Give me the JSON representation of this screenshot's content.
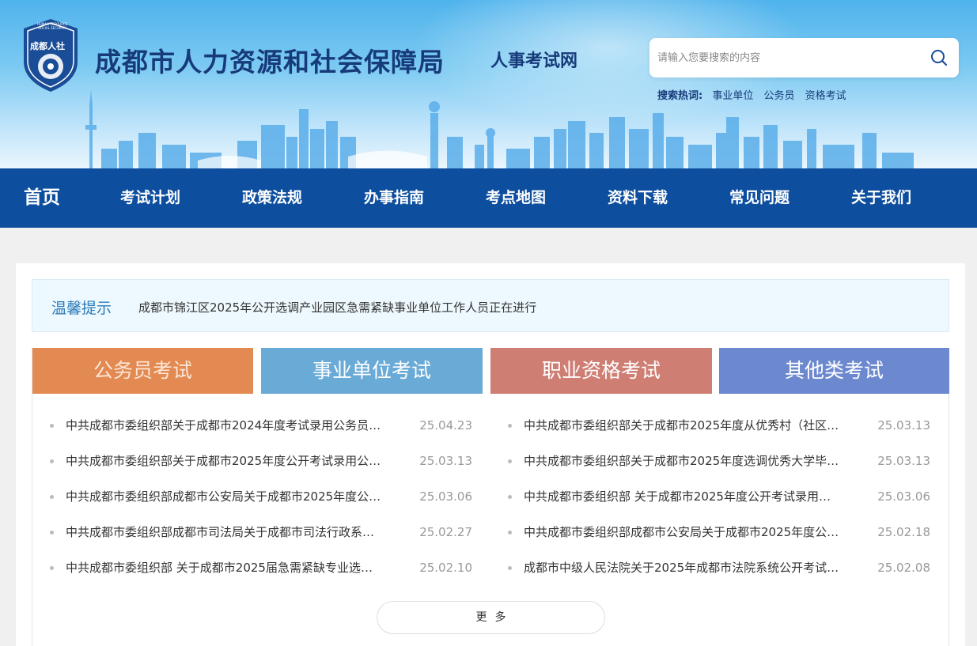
{
  "header": {
    "logo_text": "成都人社",
    "logo_ring_text": "HUMAN RESOURCE SOCIAL SECURITY",
    "title": "成都市人力资源和社会保障局",
    "subtitle": "人事考试网",
    "search": {
      "placeholder": "请输入您要搜索的内容",
      "value": ""
    },
    "hotwords": {
      "label": "搜索热词:",
      "items": [
        "事业单位",
        "公务员",
        "资格考试"
      ]
    }
  },
  "nav": {
    "items": [
      "首页",
      "考试计划",
      "政策法规",
      "办事指南",
      "考点地图",
      "资料下载",
      "常见问题",
      "关于我们"
    ]
  },
  "notice": {
    "label": "温馨提示",
    "text": "成都市锦江区2025年公开选调产业园区急需紧缺事业单位工作人员正在进行"
  },
  "tabs": [
    "公务员考试",
    "事业单位考试",
    "职业资格考试",
    "其他类考试"
  ],
  "news_left": [
    {
      "title": "中共成都市委组织部关于成都市2024年度考试录用公务员…",
      "date": "25.04.23"
    },
    {
      "title": "中共成都市委组织部关于成都市2025年度公开考试录用公…",
      "date": "25.03.13"
    },
    {
      "title": "中共成都市委组织部成都市公安局关于成都市2025年度公…",
      "date": "25.03.06"
    },
    {
      "title": "中共成都市委组织部成都市司法局关于成都市司法行政系…",
      "date": "25.02.27"
    },
    {
      "title": "中共成都市委组织部 关于成都市2025届急需紧缺专业选…",
      "date": "25.02.10"
    }
  ],
  "news_right": [
    {
      "title": "中共成都市委组织部关于成都市2025年度从优秀村（社区…",
      "date": "25.03.13"
    },
    {
      "title": "中共成都市委组织部关于成都市2025年度选调优秀大学毕…",
      "date": "25.03.13"
    },
    {
      "title": "中共成都市委组织部 关于成都市2025年度公开考试录用…",
      "date": "25.03.06"
    },
    {
      "title": "中共成都市委组织部成都市公安局关于成都市2025年度公…",
      "date": "25.02.18"
    },
    {
      "title": "成都市中级人民法院关于2025年成都市法院系统公开考试…",
      "date": "25.02.08"
    }
  ],
  "more_label": "更多",
  "colors": {
    "nav_bg": "#0d4e9e",
    "title_color": "#173b7a",
    "tab_civil": "#e38a52",
    "tab_public": "#6aaad6",
    "tab_qualification": "#cf7e74",
    "tab_other": "#6c89cf"
  }
}
